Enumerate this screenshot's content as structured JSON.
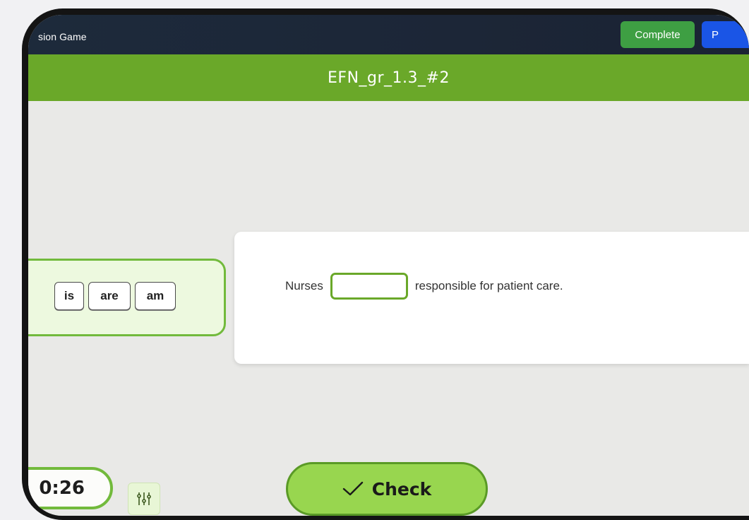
{
  "app": {
    "title": "sion Game"
  },
  "toolbar": {
    "complete_label": "Complete",
    "partial_label": "P"
  },
  "exercise": {
    "title": "EFN_gr_1.3_#2"
  },
  "word_bank": {
    "words": [
      "is",
      "are",
      "am"
    ]
  },
  "sentence": {
    "before": "Nurses",
    "blank_value": "",
    "after": "responsible for patient care."
  },
  "timer": {
    "value": "0:26"
  },
  "controls": {
    "check_label": "Check",
    "check_icon": "checkmark-icon",
    "settings_icon": "sliders-icon"
  },
  "colors": {
    "accent_green": "#6aa829",
    "complete_green": "#3e9f43",
    "blue": "#1a55e6"
  }
}
